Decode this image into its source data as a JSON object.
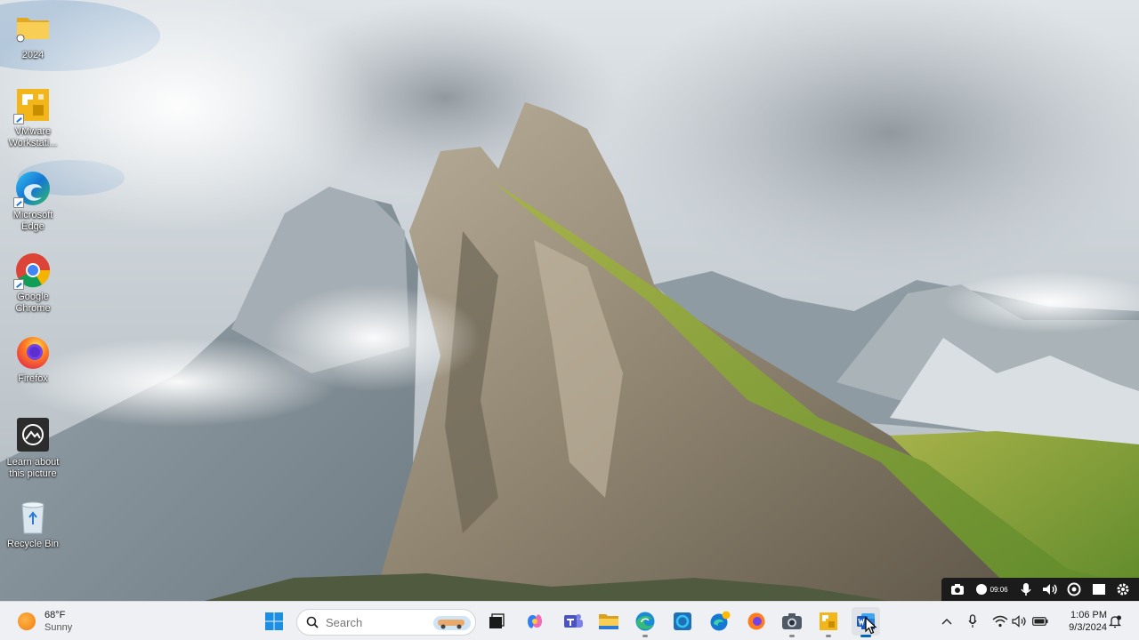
{
  "desktop": {
    "icons": [
      {
        "label": "2024",
        "icon": "folder-icon"
      },
      {
        "label": "VMware Workstati...",
        "icon": "vmware-icon"
      },
      {
        "label": "Microsoft Edge",
        "icon": "edge-icon"
      },
      {
        "label": "Google Chrome",
        "icon": "chrome-icon"
      },
      {
        "label": "Firefox",
        "icon": "firefox-icon"
      },
      {
        "label": "Learn about this picture",
        "icon": "learn-about-picture-icon"
      },
      {
        "label": "Recycle Bin",
        "icon": "recycle-bin-icon"
      }
    ]
  },
  "recorder": {
    "elapsed": "09:06",
    "controls": [
      "camera-icon",
      "record-icon",
      "microphone-icon",
      "speaker-icon",
      "webcam-icon",
      "screen-icon",
      "gear-icon"
    ]
  },
  "taskbar": {
    "weather": {
      "temp": "68°F",
      "condition": "Sunny",
      "icon": "sun-icon"
    },
    "search": {
      "placeholder": "Search"
    },
    "apps": [
      {
        "name": "start",
        "icon": "windows-icon"
      },
      {
        "name": "task-view",
        "icon": "task-view-icon"
      },
      {
        "name": "copilot",
        "icon": "copilot-icon"
      },
      {
        "name": "teams",
        "icon": "teams-icon"
      },
      {
        "name": "file-explorer",
        "icon": "folder-icon"
      },
      {
        "name": "edge",
        "icon": "edge-icon"
      },
      {
        "name": "app-square",
        "icon": "square-app-icon"
      },
      {
        "name": "edge-beta",
        "icon": "edge-beta-icon"
      },
      {
        "name": "firefox",
        "icon": "firefox-icon"
      },
      {
        "name": "camera",
        "icon": "camera-icon"
      },
      {
        "name": "vmware",
        "icon": "vmware-icon"
      },
      {
        "name": "word",
        "icon": "word-icon"
      }
    ],
    "tray": {
      "icons": [
        "chevron-up-icon",
        "microphone-icon",
        "wifi-icon",
        "volume-icon",
        "battery-icon",
        "notification-icon"
      ],
      "time": "1:06 PM",
      "date": "9/3/2024"
    }
  },
  "colors": {
    "taskbar_bg": "#eef0f3",
    "accent": "#0067c0",
    "word_blue": "#185abd",
    "folder_yellow": "#f5c13d"
  }
}
